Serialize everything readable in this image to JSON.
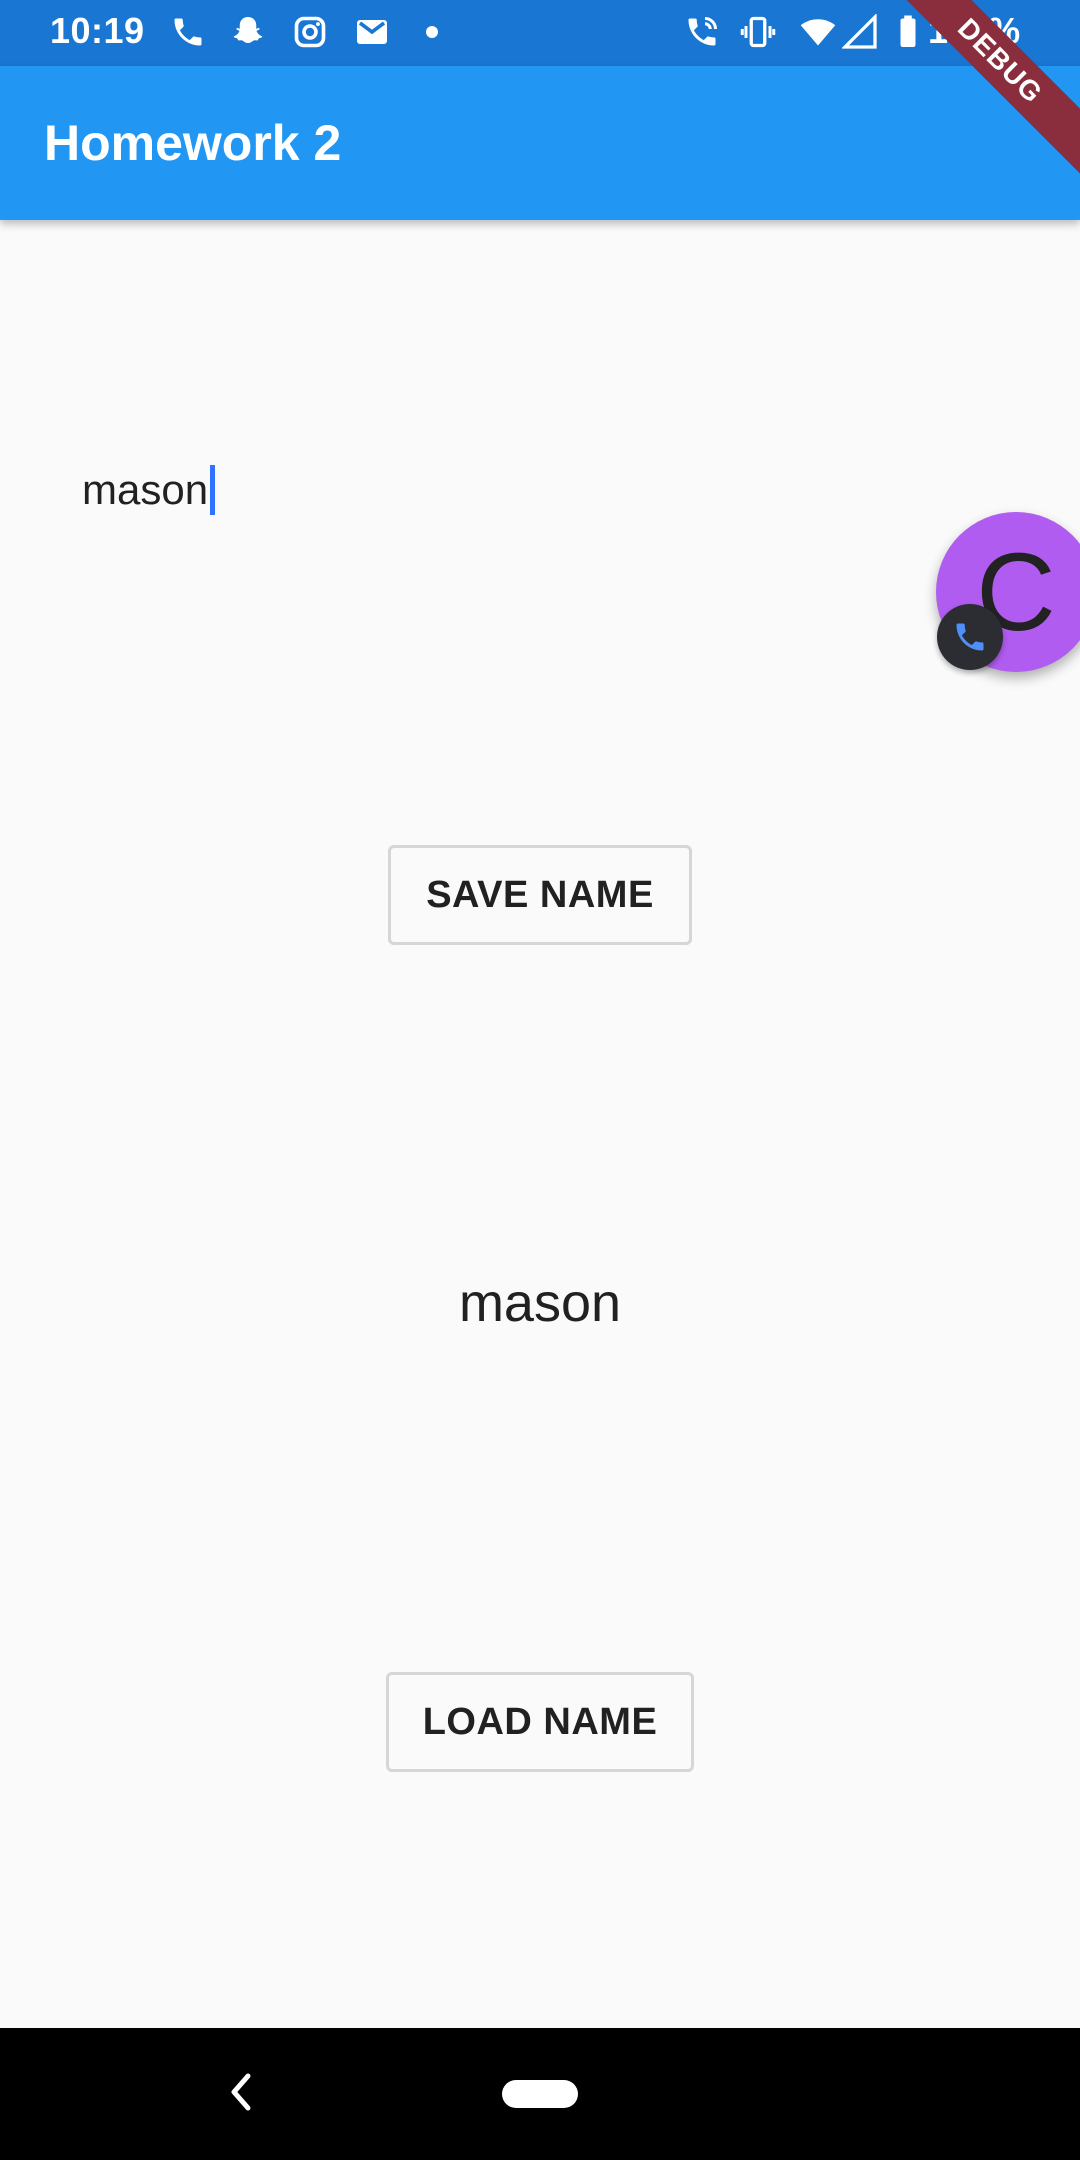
{
  "status_bar": {
    "time": "10:19",
    "battery": "100%",
    "icons": [
      "phone-icon",
      "snapchat-icon",
      "instagram-icon",
      "gmail-icon",
      "dot-icon",
      "wifi-call-icon",
      "vibrate-icon",
      "wifi-icon",
      "signal-icon",
      "battery-icon"
    ]
  },
  "app_bar": {
    "title": "Homework 2"
  },
  "debug_banner": "DEBUG",
  "form": {
    "name_input_value": "mason",
    "save_button_label": "SAVE NAME",
    "saved_name": "mason",
    "load_button_label": "LOAD NAME"
  },
  "bubble": {
    "letter": "C",
    "accent_color": "#b05cf0"
  },
  "colors": {
    "primary": "#2196f3",
    "status_bar": "#1976d2",
    "background": "#fafafa"
  }
}
